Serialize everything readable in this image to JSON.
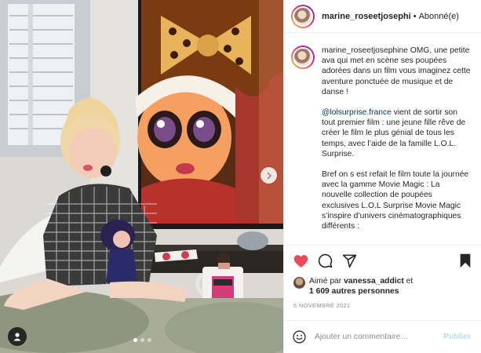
{
  "photo": {
    "alt_description": "",
    "carousel": {
      "total": 3,
      "active": 0
    },
    "icons": {
      "next": "chevron-right-icon",
      "tags": "person-tag-icon"
    }
  },
  "header": {
    "username": "marine_roseetjosephi",
    "separator": "•",
    "follow_label": "Abonné(e)"
  },
  "caption": {
    "username": "marine_roseetjosephine",
    "paragraphs": [
      {
        "mention": "",
        "text": "OMG, une petite ava qui met en scène ses poupées adorées dans un film vous imaginez cette aventure ponctuée de musique et de danse !"
      },
      {
        "mention": "@lolsurprise.france",
        "text": " vient de sortir son tout premier film : une jeune fille rêve de créer le film le plus génial de tous les temps, avec l’aide de la famille L.O.L. Surprise."
      },
      {
        "mention": "",
        "text": "Bref on s est refait le film toute la journée avec la gamme Movie Magic : La nouvelle collection de poupées exclusives L.O.L Surprise Movie Magic s’inspire d’univers cinématographiques différents :"
      }
    ]
  },
  "actions": {
    "like_icon": "heart-filled-icon",
    "comment_icon": "comment-icon",
    "share_icon": "send-icon",
    "save_icon": "bookmark-filled-icon",
    "liked": true,
    "like_color": "#ed4956"
  },
  "likes": {
    "prefix": "Aimé par ",
    "user": "vanessa_addict",
    "middle": " et",
    "others": "1 609 autres personnes"
  },
  "date": "6 NOVEMBRE 2021",
  "comment": {
    "emoji_icon": "smiley-icon",
    "placeholder": "Ajouter un commentaire…",
    "publish_label": "Publier",
    "publish_color": "#b2dffc"
  }
}
